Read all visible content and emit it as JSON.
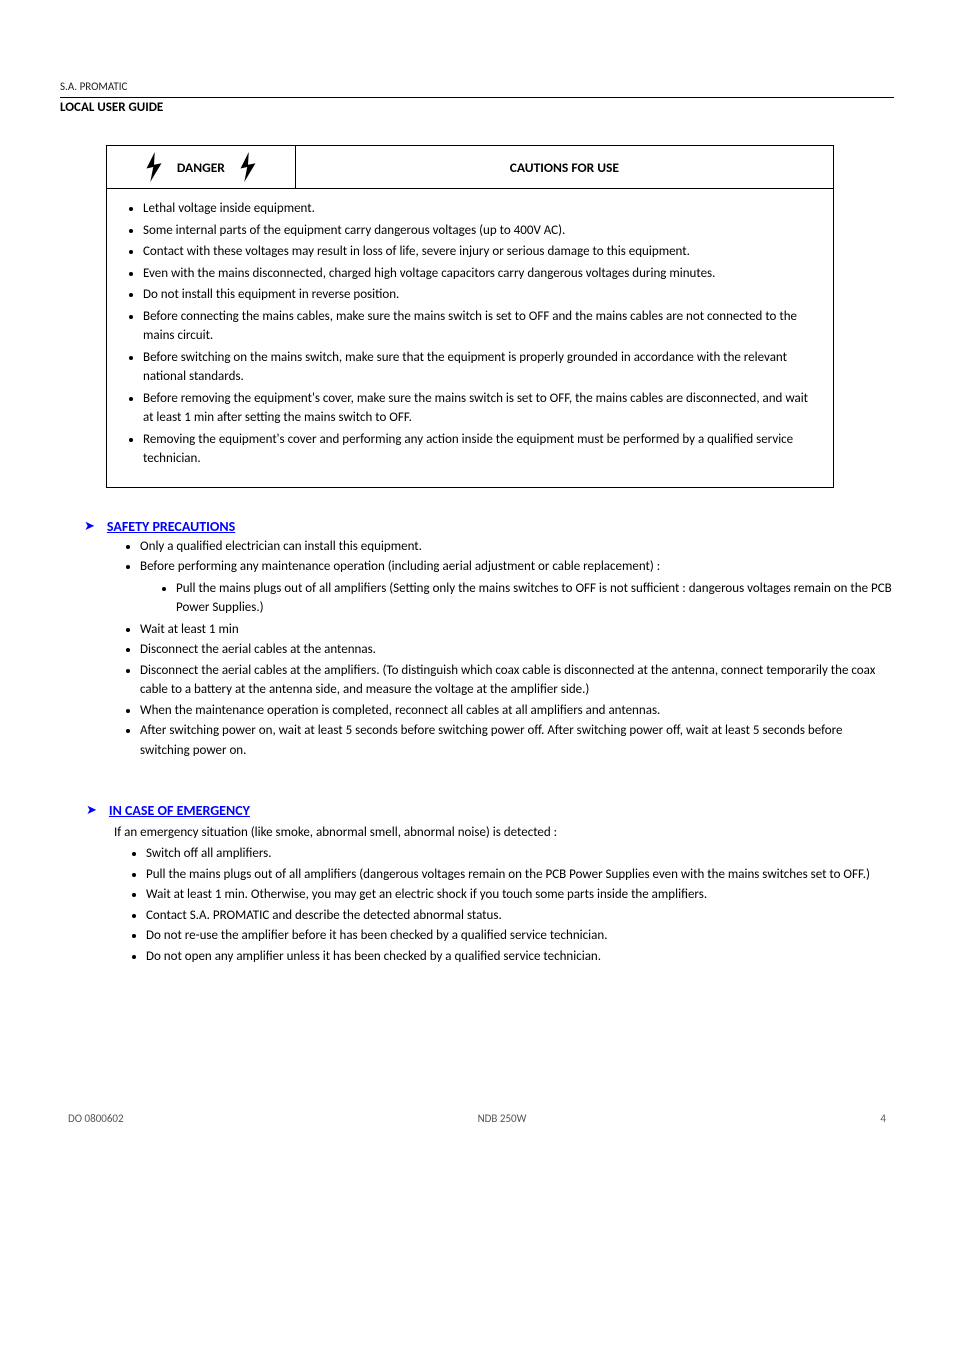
{
  "header": {
    "company": "S.A. PROMATIC",
    "guide": "LOCAL USER GUIDE"
  },
  "warning_box": {
    "caption_left": "DANGER",
    "caption_right": "CAUTIONS FOR USE",
    "items": [
      "Lethal voltage inside equipment.",
      "Some internal parts of the equipment carry dangerous voltages (up to 400V AC).",
      "Contact with these voltages may result in loss of life, severe injury or serious damage to this equipment.",
      "Even with the mains disconnected, charged high voltage capacitors carry dangerous voltages during minutes.",
      "Do not install this equipment in reverse position.",
      "Before connecting the mains cables, make sure the mains switch is set to OFF and the mains cables are not connected to the mains circuit.",
      "Before switching on the mains switch, make sure that the equipment is properly grounded in accordance with the relevant national standards.",
      "Before removing the equipment's cover, make sure the mains switch is set to OFF, the mains cables are disconnected, and wait at least 1 min after setting the mains switch to OFF.",
      "Removing the equipment's cover and performing any action inside the equipment must be performed by a qualified service technician."
    ]
  },
  "safety_section": {
    "title": "SAFETY PRECAUTIONS",
    "items": [
      {
        "text": "Only a qualified electrician can install this equipment.",
        "level": 1
      },
      {
        "text": "Before performing any maintenance operation (including aerial adjustment or cable replacement) :",
        "level": 1
      },
      {
        "text": "Pull the mains plugs out of all amplifiers (Setting only the mains switches to OFF is not sufficient : dangerous voltages remain on the PCB Power Supplies.)",
        "level": 2
      },
      {
        "text": "Wait at least 1 min",
        "level": 1
      },
      {
        "text": "Disconnect the aerial cables at the antennas.",
        "level": 1
      },
      {
        "text": "Disconnect the aerial cables at the amplifiers. (To distinguish which coax cable is disconnected at the antenna, connect temporarily the coax cable to a battery at the antenna side, and measure the voltage at the amplifier side.)",
        "level": 1
      },
      {
        "text": "When the maintenance operation is completed, reconnect all cables at all amplifiers and antennas.",
        "level": 1
      },
      {
        "text": "After switching power on, wait at least 5 seconds before switching power off. After switching power off, wait at least 5 seconds before switching power on.",
        "level": 1
      }
    ]
  },
  "emergency_section": {
    "title": "IN CASE OF EMERGENCY",
    "lead": "If an emergency situation (like smoke, abnormal smell, abnormal noise) is detected :",
    "items": [
      "Switch off all amplifiers.",
      "Pull the mains plugs out of all amplifiers (dangerous voltages remain on the PCB Power Supplies even with the mains switches set to OFF.)",
      "Wait at least 1 min. Otherwise, you may get an electric shock if you touch some parts inside the amplifiers.",
      "Contact S.A. PROMATIC and describe the detected abnormal status.",
      "Do not re-use the amplifier before it has been checked by a qualified service technician.",
      "Do not open any amplifier unless it has been checked by a qualified service technician."
    ]
  },
  "footer": {
    "left": "DO 0800602",
    "center": "NDB 250W",
    "right": "4"
  }
}
